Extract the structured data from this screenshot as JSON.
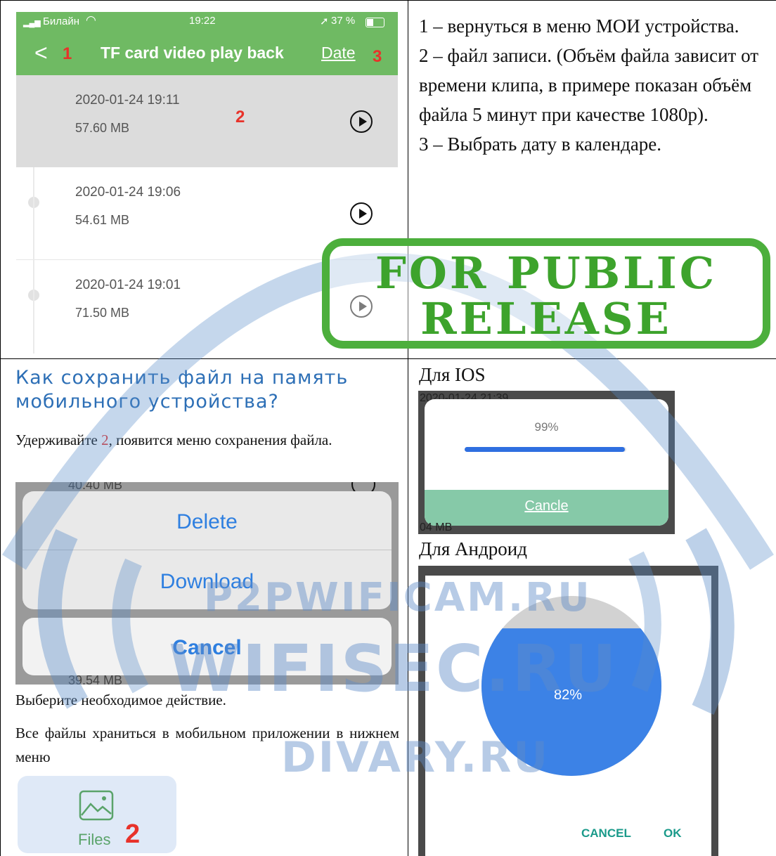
{
  "phone": {
    "carrier": "Билайн",
    "time": "19:22",
    "battery": "37 %",
    "back_marker": "1",
    "title": "TF card video play back",
    "date_link": "Date",
    "date_marker": "3",
    "selected_marker": "2",
    "recordings": [
      {
        "datetime": "2020-01-24 19:11",
        "size": "57.60 MB"
      },
      {
        "datetime": "2020-01-24 19:06",
        "size": "54.61 MB"
      },
      {
        "datetime": "2020-01-24 19:01",
        "size": "71.50 MB"
      }
    ]
  },
  "description": [
    "1 – вернуться в меню МОИ устройства.",
    "2 – файл записи. (Объём файла зависит от времени клипа, в примере показан объём файла 5 минут при качестве 1080p).",
    "3 – Выбрать дату в календаре."
  ],
  "stamp": {
    "line1": "FOR PUBLIC",
    "line2": "RELEASE"
  },
  "howto": {
    "heading": "Как сохранить файл на память мобильного устройства?",
    "hold_prefix": "Удерживайте ",
    "hold_number": "2",
    "hold_suffix": ", появится меню сохранения файла.",
    "sheet": {
      "top_size": "40.40 MB",
      "delete": "Delete",
      "download": "Download",
      "cancel": "Cancel",
      "bottom_size": "39.54 MB"
    },
    "choose": "Выберите необходимое действие.",
    "files_note": "Все файлы храниться в мобильном приложении в нижнем меню",
    "files_label": "Files",
    "files_marker": "2"
  },
  "ios": {
    "label": "Для IOS",
    "percent": "99%",
    "progress": 0.99,
    "cancel": "Cancle",
    "bg_text_top": "2020-01-24 21:39",
    "bg_text_bottom": "04 MB"
  },
  "android": {
    "label": "Для Андроид",
    "percent": "82%",
    "progress": 0.82,
    "cancel": "CANCEL",
    "ok": "OK"
  },
  "watermarks": [
    "P2PWIFICAM.RU",
    "WIFISEC.RU",
    "DIVARY.RU"
  ],
  "colors": {
    "header_green": "#6fba63",
    "stamp_green": "#3da32c",
    "link_blue": "#2d6fb6",
    "ios_blue": "#2f6fe0",
    "teal": "#86c9a8"
  }
}
